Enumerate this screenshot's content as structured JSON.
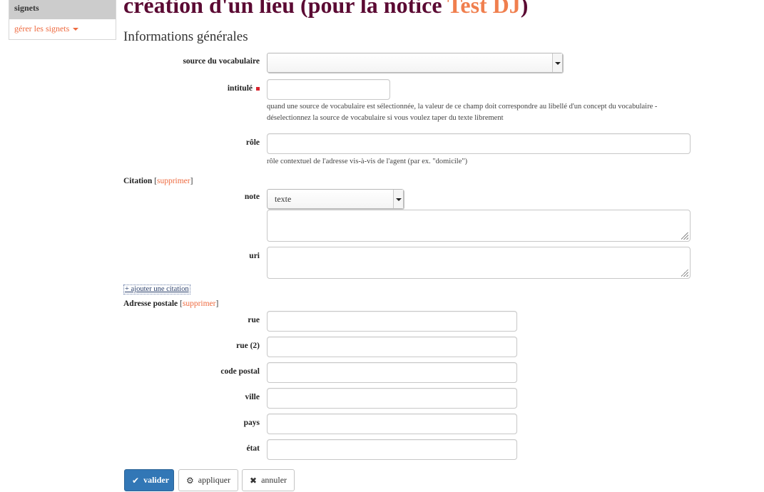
{
  "sidebar": {
    "header": "signets",
    "manage_link": "gérer les signets"
  },
  "header": {
    "title_prefix": "création d'un lieu (pour la notice ",
    "title_accent": "Test DJ",
    "title_suffix": ")"
  },
  "section": {
    "title": "Informations générales"
  },
  "form": {
    "vocab_source": {
      "label": "source du vocabulaire",
      "value": ""
    },
    "intitule": {
      "label": "intitulé",
      "value": "",
      "help": "quand une source de vocabulaire est sélectionnée, la valeur de ce champ doit correspondre au libellé d'un concept du vocabulaire - déselectionnez la source de vocabulaire si vous voulez taper du texte librement"
    },
    "role": {
      "label": "rôle",
      "value": "",
      "help": "rôle contextuel de l'adresse vis-à-vis de l'agent (par ex. \"domicile\")"
    },
    "citation": {
      "title": "Citation",
      "bracket_open": "[",
      "remove": "supprimer",
      "bracket_close": "]",
      "note_label": "note",
      "note_type": "texte",
      "note_value": "",
      "uri_label": "uri",
      "uri_value": "",
      "add_link": "+ ajouter une citation"
    },
    "address": {
      "title": "Adresse postale",
      "bracket_open": "[",
      "remove": "supprimer",
      "bracket_close": "]",
      "fields": {
        "rue": {
          "label": "rue",
          "value": ""
        },
        "rue2": {
          "label": "rue (2)",
          "value": ""
        },
        "code_postal": {
          "label": "code postal",
          "value": ""
        },
        "ville": {
          "label": "ville",
          "value": ""
        },
        "pays": {
          "label": "pays",
          "value": ""
        },
        "etat": {
          "label": "état",
          "value": ""
        }
      }
    }
  },
  "actions": {
    "validate": "valider",
    "apply": "appliquer",
    "cancel": "annuler"
  },
  "icons": {
    "validate": "check-icon",
    "apply": "gear-icon",
    "cancel": "close-icon",
    "required": "required-marker-icon"
  },
  "colors": {
    "title": "#5b0a33",
    "accent": "#f07f4e",
    "link": "#ee6a3f",
    "primary_button": "#3277b6",
    "required": "#d9232e"
  }
}
